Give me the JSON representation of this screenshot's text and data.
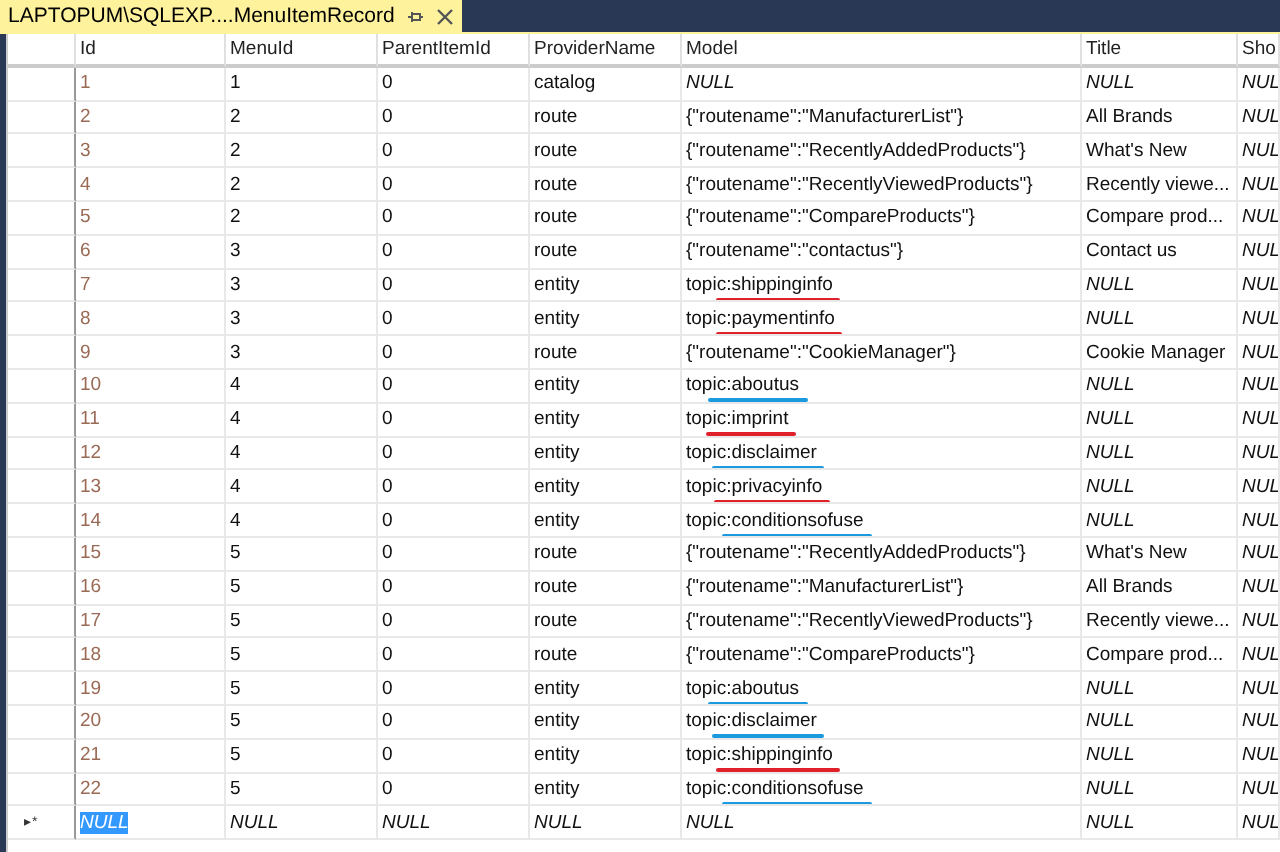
{
  "tab": {
    "title": "LAPTOPUM\\SQLEXP....MenuItemRecord",
    "selected": true
  },
  "columns": [
    "Id",
    "MenuId",
    "ParentItemId",
    "ProviderName",
    "Model",
    "Title",
    "Sho"
  ],
  "rows": [
    {
      "cells": [
        "1",
        "1",
        "0",
        "catalog",
        {
          "text": "NULL",
          "null": true
        },
        {
          "text": "NULL",
          "null": true
        },
        {
          "text": "NUL",
          "null": true
        }
      ]
    },
    {
      "cells": [
        "2",
        "2",
        "0",
        "route",
        "{\"routename\":\"ManufacturerList\"}",
        "All Brands",
        {
          "text": "NUL",
          "null": true
        }
      ]
    },
    {
      "cells": [
        "3",
        "2",
        "0",
        "route",
        "{\"routename\":\"RecentlyAddedProducts\"}",
        "What's New",
        {
          "text": "NUL",
          "null": true
        }
      ]
    },
    {
      "cells": [
        "4",
        "2",
        "0",
        "route",
        "{\"routename\":\"RecentlyViewedProducts\"}",
        "Recently viewe...",
        {
          "text": "NUL",
          "null": true
        }
      ]
    },
    {
      "cells": [
        "5",
        "2",
        "0",
        "route",
        "{\"routename\":\"CompareProducts\"}",
        "Compare prod...",
        {
          "text": "NUL",
          "null": true
        }
      ]
    },
    {
      "cells": [
        "6",
        "3",
        "0",
        "route",
        "{\"routename\":\"contactus\"}",
        "Contact us",
        {
          "text": "NUL",
          "null": true
        }
      ]
    },
    {
      "cells": [
        "7",
        "3",
        "0",
        "entity",
        "topic:shippinginfo",
        {
          "text": "NULL",
          "null": true
        },
        {
          "text": "NUL",
          "null": true
        }
      ],
      "color": "#e0202a"
    },
    {
      "cells": [
        "8",
        "3",
        "0",
        "entity",
        "topic:paymentinfo",
        {
          "text": "NULL",
          "null": true
        },
        {
          "text": "NUL",
          "null": true
        }
      ],
      "color": "#e0202a"
    },
    {
      "cells": [
        "9",
        "3",
        "0",
        "route",
        "{\"routename\":\"CookieManager\"}",
        "Cookie Manager",
        {
          "text": "NUL",
          "null": true
        }
      ]
    },
    {
      "cells": [
        "10",
        "4",
        "0",
        "entity",
        "topic:aboutus",
        {
          "text": "NULL",
          "null": true
        },
        {
          "text": "NUL",
          "null": true
        }
      ],
      "color": "#1c9ae0"
    },
    {
      "cells": [
        "11",
        "4",
        "0",
        "entity",
        "topic:imprint",
        {
          "text": "NULL",
          "null": true
        },
        {
          "text": "NUL",
          "null": true
        }
      ],
      "color": "#e0202a"
    },
    {
      "cells": [
        "12",
        "4",
        "0",
        "entity",
        "topic:disclaimer",
        {
          "text": "NULL",
          "null": true
        },
        {
          "text": "NUL",
          "null": true
        }
      ],
      "color": "#1c9ae0"
    },
    {
      "cells": [
        "13",
        "4",
        "0",
        "entity",
        "topic:privacyinfo",
        {
          "text": "NULL",
          "null": true
        },
        {
          "text": "NUL",
          "null": true
        }
      ],
      "color": "#e0202a"
    },
    {
      "cells": [
        "14",
        "4",
        "0",
        "entity",
        "topic:conditionsofuse",
        {
          "text": "NULL",
          "null": true
        },
        {
          "text": "NUL",
          "null": true
        }
      ],
      "color": "#1c9ae0"
    },
    {
      "cells": [
        "15",
        "5",
        "0",
        "route",
        "{\"routename\":\"RecentlyAddedProducts\"}",
        "What's New",
        {
          "text": "NUL",
          "null": true
        }
      ]
    },
    {
      "cells": [
        "16",
        "5",
        "0",
        "route",
        "{\"routename\":\"ManufacturerList\"}",
        "All Brands",
        {
          "text": "NUL",
          "null": true
        }
      ]
    },
    {
      "cells": [
        "17",
        "5",
        "0",
        "route",
        "{\"routename\":\"RecentlyViewedProducts\"}",
        "Recently viewe...",
        {
          "text": "NUL",
          "null": true
        }
      ]
    },
    {
      "cells": [
        "18",
        "5",
        "0",
        "route",
        "{\"routename\":\"CompareProducts\"}",
        "Compare prod...",
        {
          "text": "NUL",
          "null": true
        }
      ]
    },
    {
      "cells": [
        "19",
        "5",
        "0",
        "entity",
        "topic:aboutus",
        {
          "text": "NULL",
          "null": true
        },
        {
          "text": "NUL",
          "null": true
        }
      ],
      "color": "#1c9ae0"
    },
    {
      "cells": [
        "20",
        "5",
        "0",
        "entity",
        "topic:disclaimer",
        {
          "text": "NULL",
          "null": true
        },
        {
          "text": "NUL",
          "null": true
        }
      ],
      "color": "#1c9ae0"
    },
    {
      "cells": [
        "21",
        "5",
        "0",
        "entity",
        "topic:shippinginfo",
        {
          "text": "NULL",
          "null": true
        },
        {
          "text": "NUL",
          "null": true
        }
      ],
      "color": "#e0202a"
    },
    {
      "cells": [
        "22",
        "5",
        "0",
        "entity",
        "topic:conditionsofuse",
        {
          "text": "NULL",
          "null": true
        },
        {
          "text": "NUL",
          "null": true
        }
      ],
      "color": "#1c9ae0"
    }
  ],
  "new_row": {
    "marker": "▸*",
    "cells": [
      {
        "text": "NULL",
        "null": true,
        "selected": true
      },
      {
        "text": "NULL",
        "null": true,
        "selected": false
      },
      {
        "text": "NULL",
        "null": true,
        "selected": false
      },
      {
        "text": "NULL",
        "null": true,
        "selected": false
      },
      {
        "text": "NULL",
        "null": true,
        "selected": false
      },
      {
        "text": "NULL",
        "null": true,
        "selected": false
      },
      {
        "text": "NUL",
        "null": true,
        "selected": false
      }
    ]
  }
}
